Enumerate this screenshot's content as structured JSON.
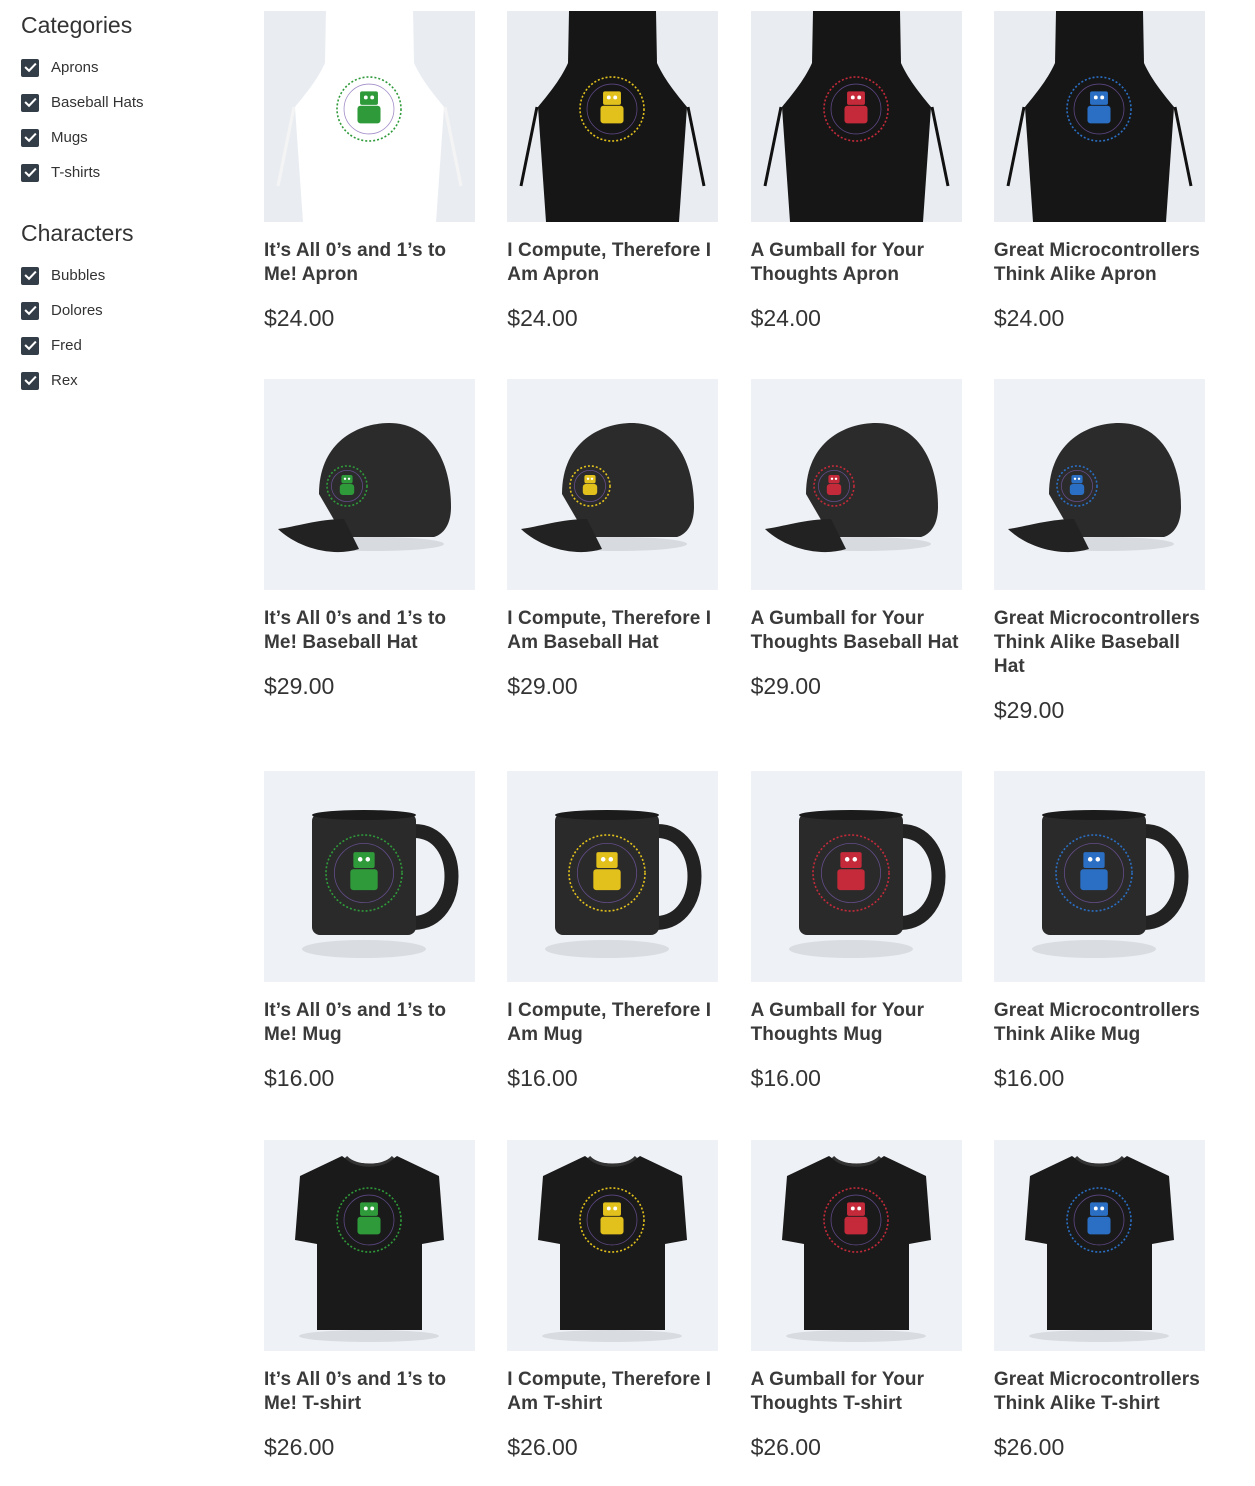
{
  "filters": {
    "categories": {
      "title": "Categories",
      "items": [
        {
          "label": "Aprons",
          "checked": true
        },
        {
          "label": "Baseball Hats",
          "checked": true
        },
        {
          "label": "Mugs",
          "checked": true
        },
        {
          "label": "T-shirts",
          "checked": true
        }
      ]
    },
    "characters": {
      "title": "Characters",
      "items": [
        {
          "label": "Bubbles",
          "checked": true
        },
        {
          "label": "Dolores",
          "checked": true
        },
        {
          "label": "Fred",
          "checked": true
        },
        {
          "label": "Rex",
          "checked": true
        }
      ]
    }
  },
  "colors": {
    "checkbox": "#333d47",
    "thumb_bg": "#eef1f5",
    "character_green": "#2f9a3a",
    "character_yellow": "#e2c11c",
    "character_red": "#c42a3a",
    "character_blue": "#2a6fc4"
  },
  "products": [
    {
      "name": "It’s All 0’s and 1’s to Me! Apron",
      "price": "$24.00",
      "type": "apron-white",
      "character": "green",
      "icon": "apron-icon"
    },
    {
      "name": "I Compute, Therefore I Am Apron",
      "price": "$24.00",
      "type": "apron",
      "character": "yellow",
      "icon": "apron-icon"
    },
    {
      "name": "A Gumball for Your Thoughts Apron",
      "price": "$24.00",
      "type": "apron",
      "character": "red",
      "icon": "apron-icon"
    },
    {
      "name": "Great Microcontrollers Think Alike Apron",
      "price": "$24.00",
      "type": "apron",
      "character": "blue",
      "icon": "apron-icon"
    },
    {
      "name": "It’s All 0’s and 1’s to Me! Baseball Hat",
      "price": "$29.00",
      "type": "hat",
      "character": "green",
      "icon": "hat-icon"
    },
    {
      "name": "I Compute, Therefore I Am Baseball Hat",
      "price": "$29.00",
      "type": "hat",
      "character": "yellow",
      "icon": "hat-icon"
    },
    {
      "name": "A Gumball for Your Thoughts Baseball Hat",
      "price": "$29.00",
      "type": "hat",
      "character": "red",
      "icon": "hat-icon"
    },
    {
      "name": "Great Microcontrollers Think Alike Baseball Hat",
      "price": "$29.00",
      "type": "hat",
      "character": "blue",
      "icon": "hat-icon"
    },
    {
      "name": "It’s All 0’s and 1’s to Me! Mug",
      "price": "$16.00",
      "type": "mug",
      "character": "green",
      "icon": "mug-icon"
    },
    {
      "name": "I Compute, Therefore I Am Mug",
      "price": "$16.00",
      "type": "mug",
      "character": "yellow",
      "icon": "mug-icon"
    },
    {
      "name": "A Gumball for Your Thoughts Mug",
      "price": "$16.00",
      "type": "mug",
      "character": "red",
      "icon": "mug-icon"
    },
    {
      "name": "Great Microcontrollers Think Alike Mug",
      "price": "$16.00",
      "type": "mug",
      "character": "blue",
      "icon": "mug-icon"
    },
    {
      "name": "It’s All 0’s and 1’s to Me! T-shirt",
      "price": "$26.00",
      "type": "tshirt",
      "character": "green",
      "icon": "tshirt-icon"
    },
    {
      "name": "I Compute, Therefore I Am T-shirt",
      "price": "$26.00",
      "type": "tshirt",
      "character": "yellow",
      "icon": "tshirt-icon"
    },
    {
      "name": "A Gumball for Your Thoughts T-shirt",
      "price": "$26.00",
      "type": "tshirt",
      "character": "red",
      "icon": "tshirt-icon"
    },
    {
      "name": "Great Microcontrollers Think Alike T-shirt",
      "price": "$26.00",
      "type": "tshirt",
      "character": "blue",
      "icon": "tshirt-icon"
    }
  ]
}
